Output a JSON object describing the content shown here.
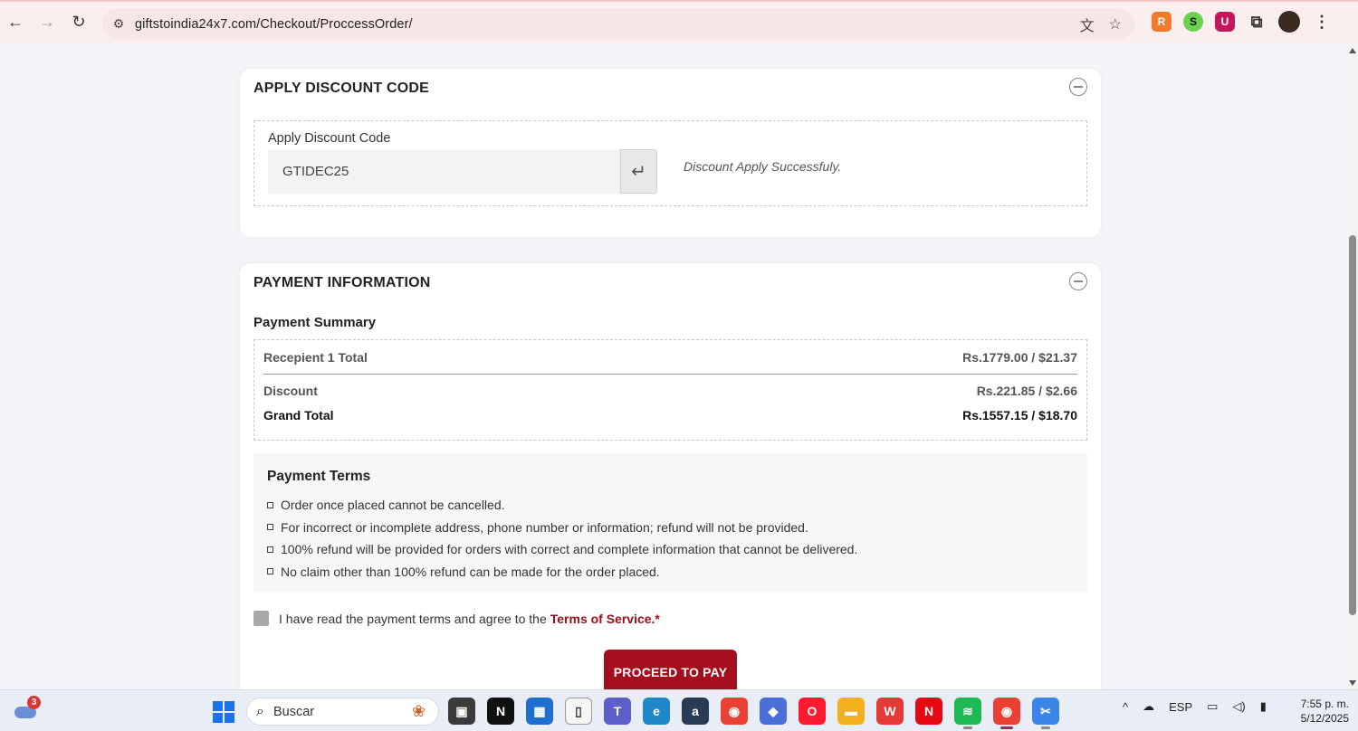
{
  "browser": {
    "url": "giftstoindia24x7.com/Checkout/ProccessOrder/",
    "back_icon": "←",
    "forward_icon": "→",
    "reload_icon": "↻",
    "site_info_icon": "⚙",
    "translate_icon": "文",
    "bookmark_icon": "☆",
    "extensions": [
      {
        "name": "r-extension",
        "glyph": "R"
      },
      {
        "name": "s-extension",
        "glyph": "S"
      },
      {
        "name": "u-extension",
        "glyph": "U"
      }
    ],
    "puzzle_icon": "⧉",
    "menu_icon": "⋮"
  },
  "discount_section": {
    "title": "APPLY DISCOUNT CODE",
    "label": "Apply Discount Code",
    "code_value": "GTIDEC25",
    "apply_icon": "↵",
    "status_message": "Discount Apply Successfuly."
  },
  "payment_section": {
    "title": "PAYMENT INFORMATION",
    "summary_title": "Payment Summary",
    "rows": [
      {
        "label": "Recepient 1 Total",
        "value": "Rs.1779.00 / $21.37"
      },
      {
        "label": "Discount",
        "value": "Rs.221.85 / $2.66"
      },
      {
        "label": "Grand Total",
        "value": "Rs.1557.15 / $18.70"
      }
    ],
    "terms_title": "Payment Terms",
    "terms": [
      "Order once placed cannot be cancelled.",
      "For incorrect or incomplete address, phone number or information; refund will not be provided.",
      "100% refund will be provided for orders with correct and complete information that cannot be delivered.",
      "No claim other than 100% refund can be made for the order placed."
    ],
    "agree_text": "I have read the payment terms and agree to the",
    "tos_link": "Terms of Service.*",
    "proceed_button": "PROCEED TO PAY"
  },
  "taskbar": {
    "weather_badge": "3",
    "search_placeholder": "Buscar",
    "apps": [
      {
        "name": "file-explorer-dark",
        "glyph": "▣",
        "color": "#3b3b3b"
      },
      {
        "name": "notion",
        "glyph": "N",
        "color": "#111111"
      },
      {
        "name": "microsoft-store",
        "glyph": "▦",
        "color": "#1f6fd1"
      },
      {
        "name": "notepad",
        "glyph": "▯",
        "color": "#f5f5f5"
      },
      {
        "name": "teams",
        "glyph": "T",
        "color": "#5b5fc7"
      },
      {
        "name": "edge",
        "glyph": "e",
        "color": "#1e88c8"
      },
      {
        "name": "amazon",
        "glyph": "a",
        "color": "#2a3b55"
      },
      {
        "name": "chrome",
        "glyph": "◉",
        "color": "#e94235"
      },
      {
        "name": "copilot",
        "glyph": "◆",
        "color": "#4a6fd8"
      },
      {
        "name": "opera",
        "glyph": "O",
        "color": "#ff1b2d"
      },
      {
        "name": "folders",
        "glyph": "▬",
        "color": "#f2b01e"
      },
      {
        "name": "wps",
        "glyph": "W",
        "color": "#e53935"
      },
      {
        "name": "netflix",
        "glyph": "N",
        "color": "#e50914"
      },
      {
        "name": "spotify",
        "glyph": "≋",
        "color": "#1db954"
      },
      {
        "name": "chrome-profile",
        "glyph": "◉",
        "color": "#e94235"
      },
      {
        "name": "snipping-tool",
        "glyph": "✂",
        "color": "#3a86e8"
      }
    ],
    "tray_chevron": "^",
    "tray_cloud_off": "☁",
    "language": "ESP",
    "time": "7:55 p. m.",
    "date": "5/12/2025"
  }
}
